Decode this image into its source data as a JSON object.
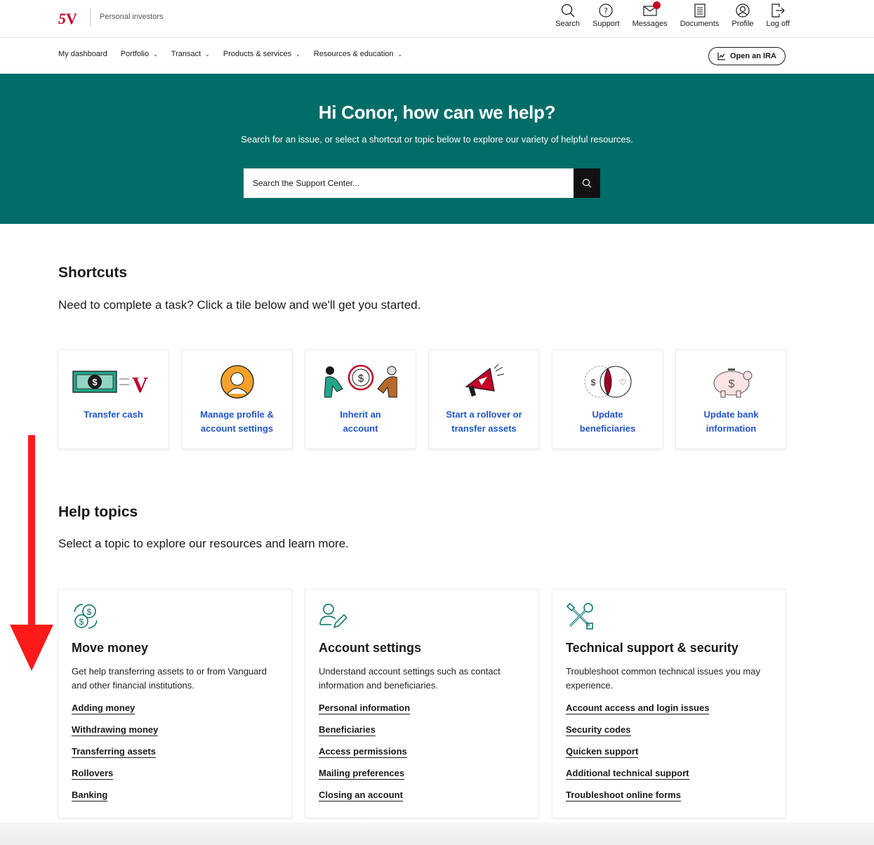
{
  "header": {
    "portal_label": "Personal investors",
    "util": [
      {
        "label": "Search",
        "icon": "search-icon"
      },
      {
        "label": "Support",
        "icon": "help-icon"
      },
      {
        "label": "Messages",
        "icon": "mail-icon"
      },
      {
        "label": "Documents",
        "icon": "document-icon"
      },
      {
        "label": "Profile",
        "icon": "profile-icon"
      },
      {
        "label": "Log off",
        "icon": "logoff-icon"
      }
    ]
  },
  "nav": {
    "items": [
      "My dashboard",
      "Portfolio",
      "Transact",
      "Products & services",
      "Resources & education"
    ],
    "ira_button": "Open an IRA"
  },
  "hero": {
    "title": "Hi Conor, how can we help?",
    "subtitle": "Search for an issue, or select a shortcut or topic below to explore our variety of helpful resources.",
    "search_placeholder": "Search the Support Center..."
  },
  "shortcuts": {
    "title": "Shortcuts",
    "subtitle": "Need to complete a task? Click a tile below and we'll get you started.",
    "tiles": [
      {
        "line1": "Transfer cash",
        "line2": ""
      },
      {
        "line1": "Manage profile &",
        "line2": "account settings"
      },
      {
        "line1": "Inherit an",
        "line2": "account"
      },
      {
        "line1": "Start a rollover or",
        "line2": "transfer assets"
      },
      {
        "line1": "Update",
        "line2": "beneficiaries"
      },
      {
        "line1": "Update bank",
        "line2": "information"
      }
    ]
  },
  "help": {
    "title": "Help topics",
    "subtitle": "Select a topic to explore our resources and learn more.",
    "topics": [
      {
        "title": "Move money",
        "desc": "Get help transferring assets to or from Vanguard and other financial institutions.",
        "links": [
          "Adding money",
          "Withdrawing money",
          "Transferring assets",
          "Rollovers",
          "Banking"
        ]
      },
      {
        "title": "Account settings",
        "desc": "Understand account settings such as contact information and beneficiaries.",
        "links": [
          "Personal information",
          "Beneficiaries",
          "Access permissions",
          "Mailing preferences",
          "Closing an account"
        ]
      },
      {
        "title": "Technical support & security",
        "desc": "Troubleshoot common technical issues you may experience.",
        "links": [
          "Account access and login issues",
          "Security codes",
          "Quicken support",
          "Additional technical support",
          "Troubleshoot online forms"
        ]
      }
    ]
  },
  "colors": {
    "brand_red": "#c20029",
    "hero_teal": "#006d68",
    "link_blue": "#1f55c9",
    "icon_teal": "#006d68"
  }
}
